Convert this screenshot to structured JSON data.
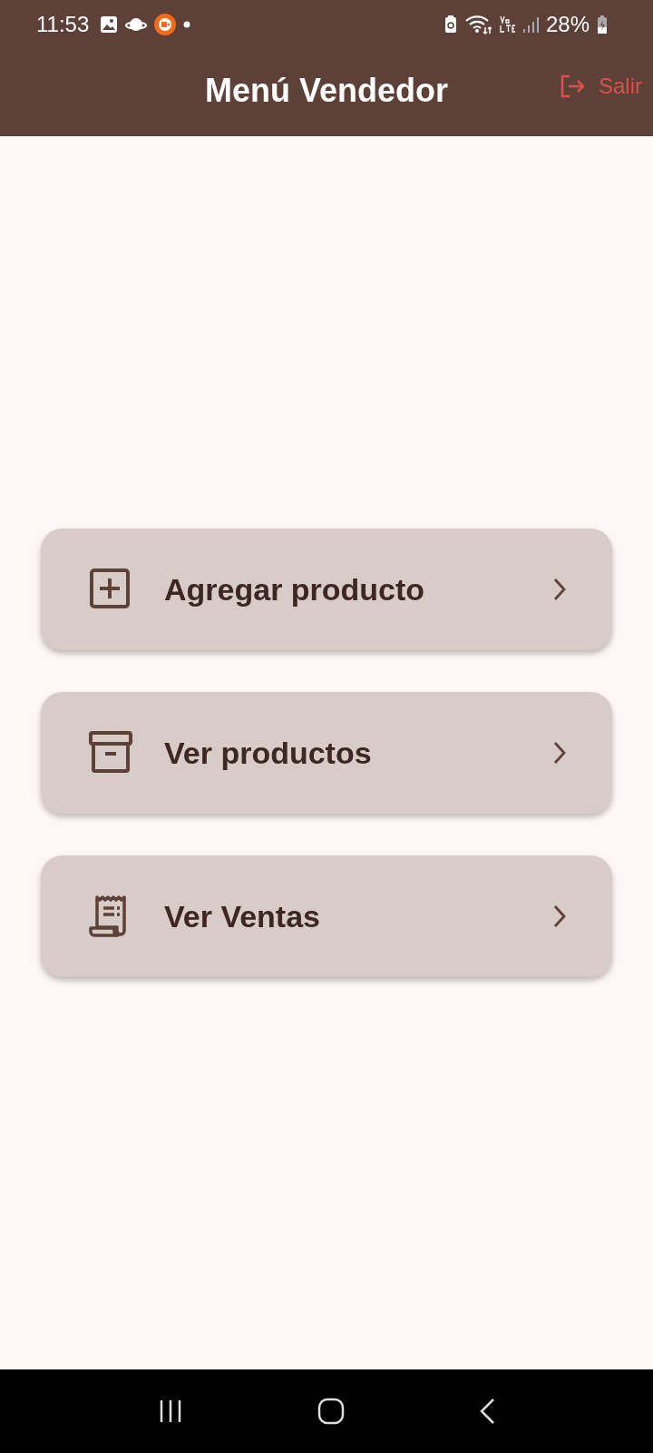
{
  "status_bar": {
    "time": "11:53",
    "battery": "28%"
  },
  "app_bar": {
    "title": "Menú Vendedor",
    "action": {
      "label": "Salir"
    }
  },
  "menu_items": [
    {
      "kind": "add",
      "label": "Agregar producto"
    },
    {
      "kind": "archive",
      "label": "Ver productos"
    },
    {
      "kind": "receipt",
      "label": "Ver Ventas"
    }
  ]
}
